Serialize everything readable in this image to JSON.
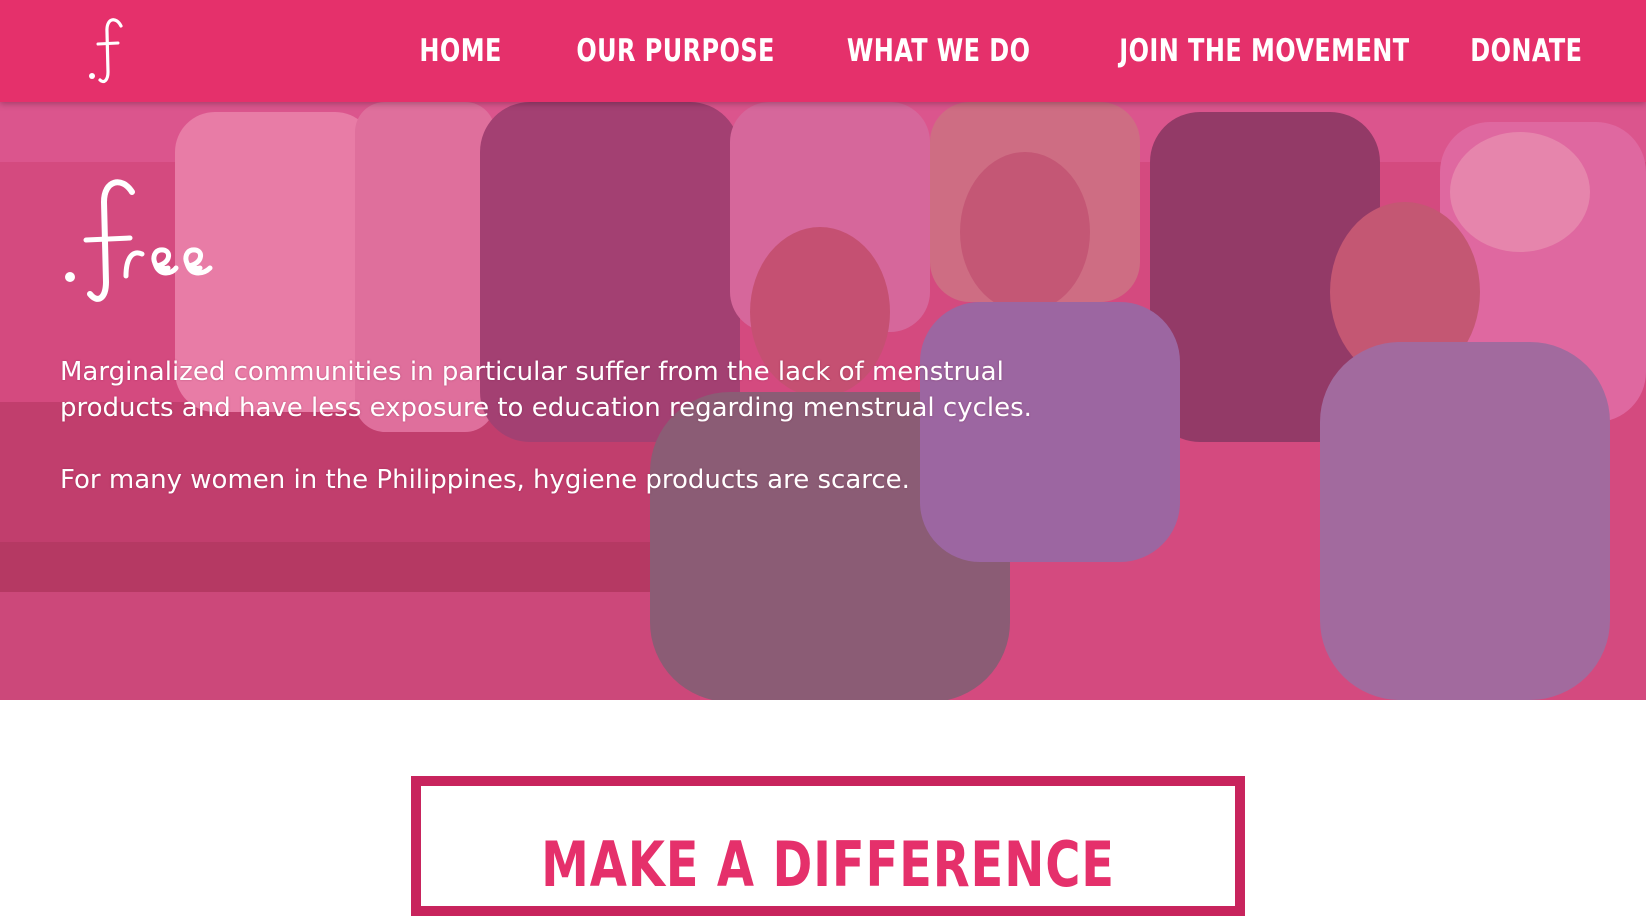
{
  "header": {
    "logo_icon": "f-script-logo-icon",
    "nav": [
      {
        "label": "HOME"
      },
      {
        "label": "OUR PURPOSE"
      },
      {
        "label": "WHAT WE DO"
      },
      {
        "label": "JOIN THE MOVEMENT"
      },
      {
        "label": "DONATE"
      }
    ],
    "background_color": "#e5306b"
  },
  "hero": {
    "logo_icon": "free-script-logo-icon",
    "paragraph_1": "Marginalized communities in particular suffer from the lack of menstrual products and have less exposure to education regarding menstrual cycles.",
    "paragraph_2": "For many women in the Philippines, hygiene products are scarce.",
    "overlay_color": "#e5306b"
  },
  "cta": {
    "title": "MAKE A DIFFERENCE",
    "border_color": "#c8245d",
    "text_color": "#e5306b"
  }
}
